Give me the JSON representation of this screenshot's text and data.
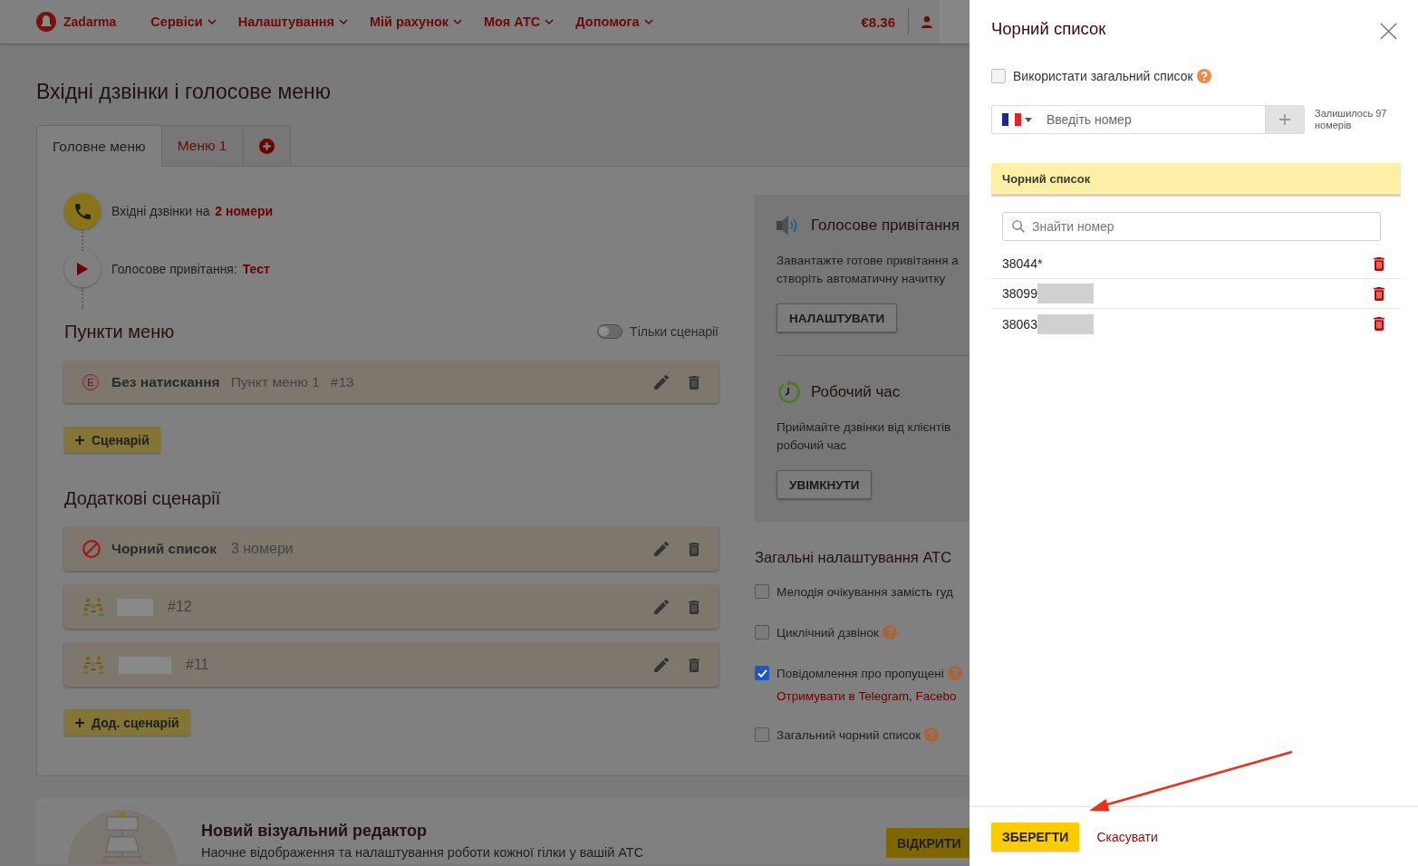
{
  "nav": {
    "logo": "Zadarma",
    "items": [
      {
        "label": "Сервіси"
      },
      {
        "label": "Налаштування"
      },
      {
        "label": "Мій рахунок"
      },
      {
        "label": "Моя АТС"
      },
      {
        "label": "Допомога"
      }
    ],
    "balance": "€8.36"
  },
  "page": {
    "title": "Вхідні дзвінки і голосове меню",
    "tabs": [
      {
        "kind": "text",
        "label": "Головне меню",
        "selected": true
      },
      {
        "kind": "text",
        "label": "Меню 1",
        "selected": false
      },
      {
        "kind": "add",
        "selected": false
      }
    ]
  },
  "flow": [
    {
      "kind": "incoming",
      "text": "Вхідні дзвінки на",
      "link": "2 номери"
    },
    {
      "kind": "greeting",
      "text": "Голосове привітання:",
      "link": "Тест"
    }
  ],
  "menu_items": {
    "heading": "Пункти меню",
    "toggle": {
      "label": "Тільки сценарії",
      "on": false
    },
    "rows": [
      {
        "badge": "E",
        "title": "Без натискання",
        "subtitle": "Пункт меню 1",
        "number": "#13"
      }
    ],
    "add_button": "Сценарій"
  },
  "scenarios": {
    "heading": "Додаткові сценарії",
    "rows": [
      {
        "kind": "blacklist",
        "title": "Чорний список",
        "subtitle": "3 номери",
        "redacted": false
      },
      {
        "kind": "group",
        "number": "#12",
        "redacted": true
      },
      {
        "kind": "group",
        "number": "#11",
        "redacted": true
      }
    ],
    "add_button": "Дод. сценарій"
  },
  "features": [
    {
      "kind": "greeting",
      "title": "Голосове привітання",
      "description": [
        "Завантажте готове привітання а",
        "створіть автоматичну начитку"
      ],
      "button": "НАЛАШТУВАТИ"
    },
    {
      "kind": "schedule",
      "title": "Робочий час",
      "description": [
        "Приймайте дзвінки від клієнтів",
        "робочий час"
      ],
      "button": "УВІМКНУТИ"
    }
  ],
  "settings": {
    "heading": "Загальні налаштування АТС",
    "items": [
      {
        "label": "Мелодія очікування замість гуд",
        "checked": false,
        "help": false
      },
      {
        "label": "Циклічний дзвінок",
        "checked": false,
        "help": true
      },
      {
        "label": "Повідомлення про пропущені",
        "checked": true,
        "help": true,
        "link": "Отримувати в Telegram, Facebo"
      },
      {
        "label": "Загальний чорний список",
        "checked": false,
        "help": true
      }
    ]
  },
  "promo": {
    "title": "Новий візуальний редактор",
    "text": "Наочне відображення та налаштування роботи кожної гілки у вашій АТС",
    "button": "ВІДКРИТИ"
  },
  "drawer": {
    "title": "Чорний список",
    "use_common": {
      "label": "Використати загальний список",
      "checked": false,
      "help": true
    },
    "phone_input": {
      "placeholder": "Введіть номер"
    },
    "remaining": "Залишилось 97 номерів",
    "list": {
      "header": "Чорний список",
      "search_placeholder": "Знайти номер",
      "numbers": [
        {
          "number": "38044*",
          "redacted": false
        },
        {
          "number": "38099",
          "redacted": true
        },
        {
          "number": "38063",
          "redacted": true
        }
      ]
    },
    "save": "ЗБЕРЕГТИ",
    "cancel": "Скасувати"
  }
}
